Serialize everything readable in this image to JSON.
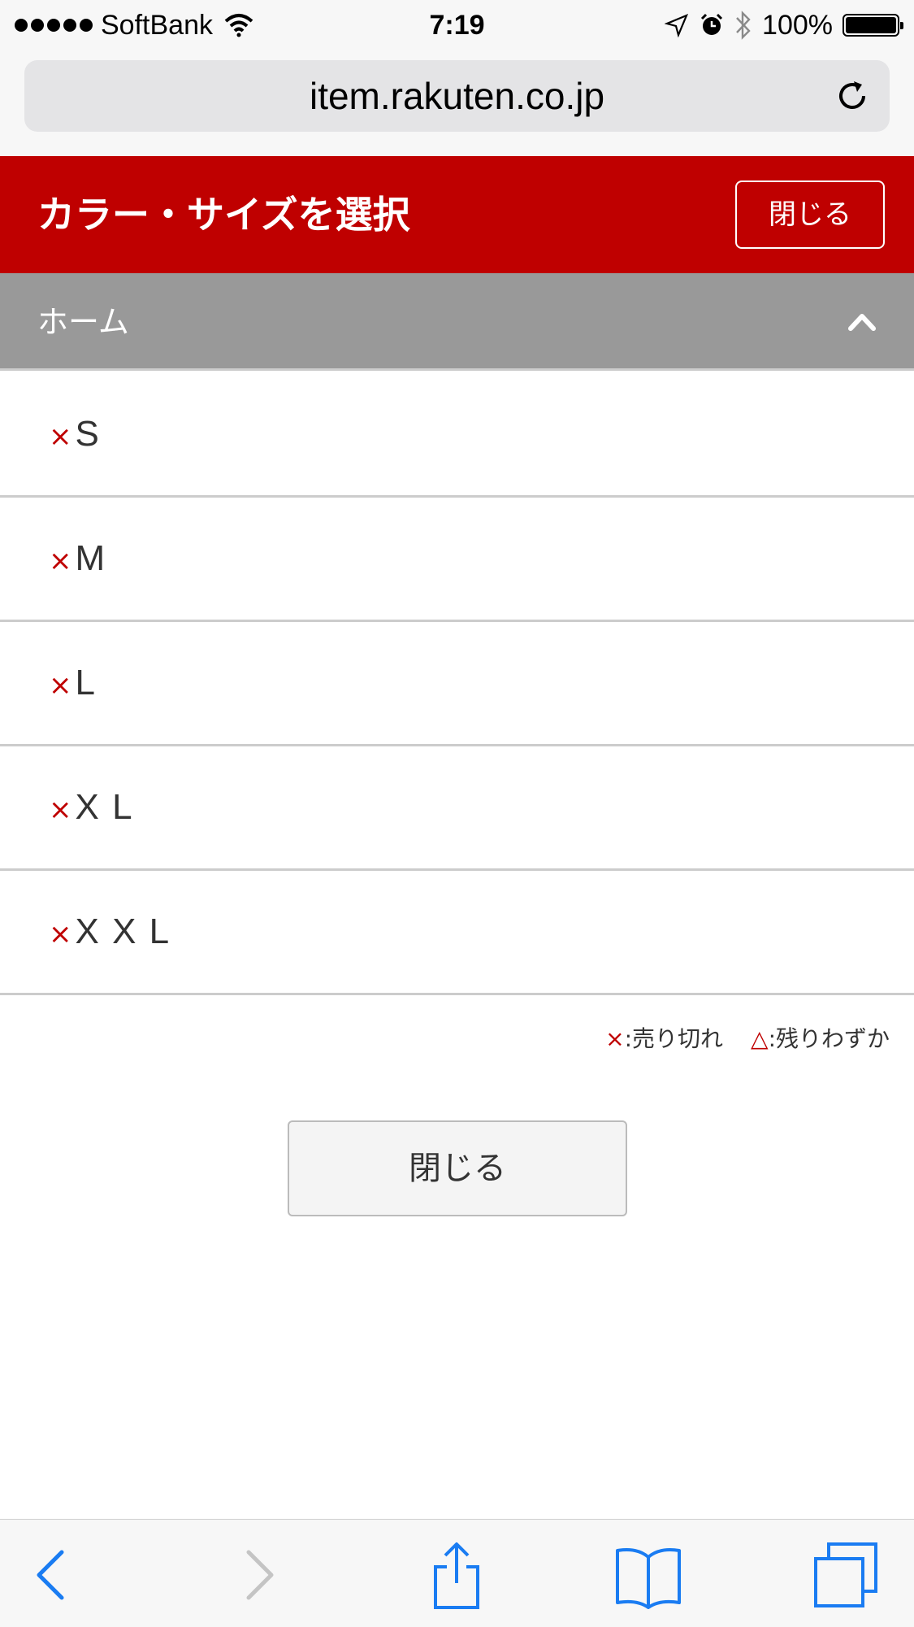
{
  "status_bar": {
    "carrier": "SoftBank",
    "time": "7:19",
    "battery_percent": "100%",
    "icons": [
      "signal-dots-icon",
      "wifi-icon",
      "location-icon",
      "alarm-icon",
      "bluetooth-icon",
      "battery-icon"
    ]
  },
  "browser": {
    "url": "item.rakuten.co.jp",
    "reload_icon": "reload-icon"
  },
  "header": {
    "title": "カラー・サイズを選択",
    "close_label": "閉じる"
  },
  "section": {
    "title": "ホーム",
    "icon": "chevron-up-icon"
  },
  "sizes": [
    {
      "mark": "×",
      "label": "S"
    },
    {
      "mark": "×",
      "label": "M"
    },
    {
      "mark": "×",
      "label": "L"
    },
    {
      "mark": "×",
      "label": "X L"
    },
    {
      "mark": "×",
      "label": "X X L"
    }
  ],
  "legend": {
    "sold_out_mark": "×",
    "sold_out_label": ":売り切れ",
    "few_left_mark": "△",
    "few_left_label": ":残りわずか"
  },
  "close_button_label": "閉じる",
  "toolbar": {
    "icons": [
      "back-icon",
      "forward-icon",
      "share-icon",
      "bookmarks-icon",
      "tabs-icon"
    ]
  },
  "colors": {
    "accent_red": "#bf0000",
    "section_gray": "#999999",
    "ios_blue": "#1a7cf2"
  }
}
